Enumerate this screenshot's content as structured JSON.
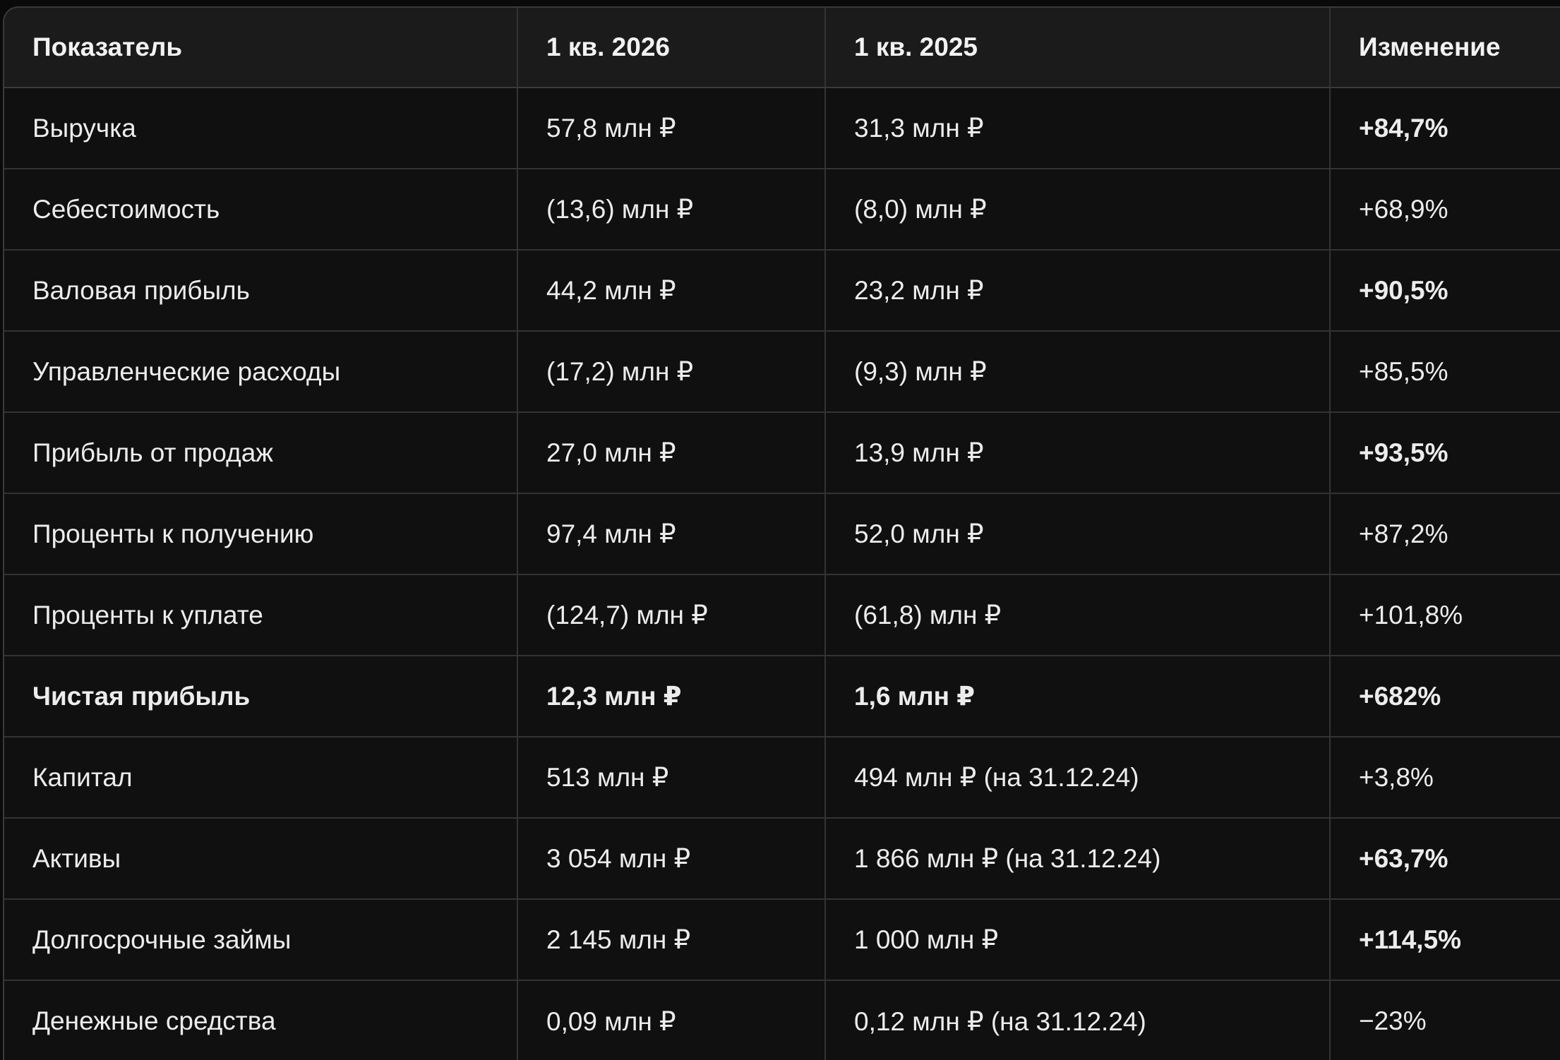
{
  "table": {
    "headers": [
      "Показатель",
      "1 кв. 2026",
      "1 кв. 2025",
      "Изменение"
    ],
    "rows": [
      {
        "label": "Выручка",
        "q2026": "57,8 млн ₽",
        "q2025": "31,3 млн ₽",
        "change": "+84,7%"
      },
      {
        "label": "Себестоимость",
        "q2026": "(13,6) млн ₽",
        "q2025": "(8,0) млн ₽",
        "change": "+68,9%"
      },
      {
        "label": "Валовая прибыль",
        "q2026": "44,2 млн ₽",
        "q2025": "23,2 млн ₽",
        "change": "+90,5%"
      },
      {
        "label": "Управленческие расходы",
        "q2026": "(17,2) млн ₽",
        "q2025": "(9,3) млн ₽",
        "change": "+85,5%"
      },
      {
        "label": "Прибыль от продаж",
        "q2026": "27,0 млн ₽",
        "q2025": "13,9 млн ₽",
        "change": "+93,5%"
      },
      {
        "label": "Проценты к получению",
        "q2026": "97,4 млн ₽",
        "q2025": "52,0 млн ₽",
        "change": "+87,2%"
      },
      {
        "label": "Проценты к уплате",
        "q2026": "(124,7) млн ₽",
        "q2025": "(61,8) млн ₽",
        "change": "+101,8%"
      },
      {
        "label": "Чистая прибыль",
        "q2026": "12,3 млн ₽",
        "q2025": "1,6 млн ₽",
        "change": "+682%"
      },
      {
        "label": "Капитал",
        "q2026": "513 млн ₽",
        "q2025": "494 млн ₽ (на 31.12.24)",
        "change": "+3,8%"
      },
      {
        "label": "Активы",
        "q2026": "3 054 млн ₽",
        "q2025": "1 866 млн ₽ (на 31.12.24)",
        "change": "+63,7%"
      },
      {
        "label": "Долгосрочные займы",
        "q2026": "2 145 млн ₽",
        "q2025": "1 000 млн ₽",
        "change": "+114,5%"
      },
      {
        "label": "Денежные средства",
        "q2026": "0,09 млн ₽",
        "q2025": "0,12 млн ₽ (на 31.12.24)",
        "change": "−23%"
      }
    ]
  }
}
